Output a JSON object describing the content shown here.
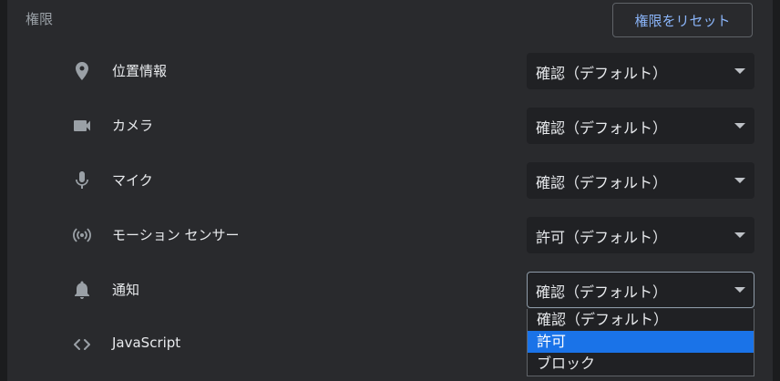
{
  "section": {
    "title": "権限",
    "reset_label": "権限をリセット"
  },
  "permissions": [
    {
      "label": "位置情報",
      "icon": "location-pin-icon",
      "value": "確認（デフォルト）"
    },
    {
      "label": "カメラ",
      "icon": "camera-icon",
      "value": "確認（デフォルト）"
    },
    {
      "label": "マイク",
      "icon": "microphone-icon",
      "value": "確認（デフォルト）"
    },
    {
      "label": "モーション センサー",
      "icon": "motion-sensor-icon",
      "value": "許可（デフォルト）"
    },
    {
      "label": "通知",
      "icon": "bell-icon",
      "value": "確認（デフォルト）"
    },
    {
      "label": "JavaScript",
      "icon": "code-brackets-icon"
    }
  ],
  "dropdown": {
    "options": [
      "確認（デフォルト）",
      "許可",
      "ブロック"
    ],
    "highlighted_index": 1
  },
  "colors": {
    "background": "#292a2d",
    "select_bg": "#202124",
    "text": "#e8eaed",
    "muted_text": "#9aa0a6",
    "link": "#8ab4f8",
    "highlight": "#1a73e8"
  }
}
